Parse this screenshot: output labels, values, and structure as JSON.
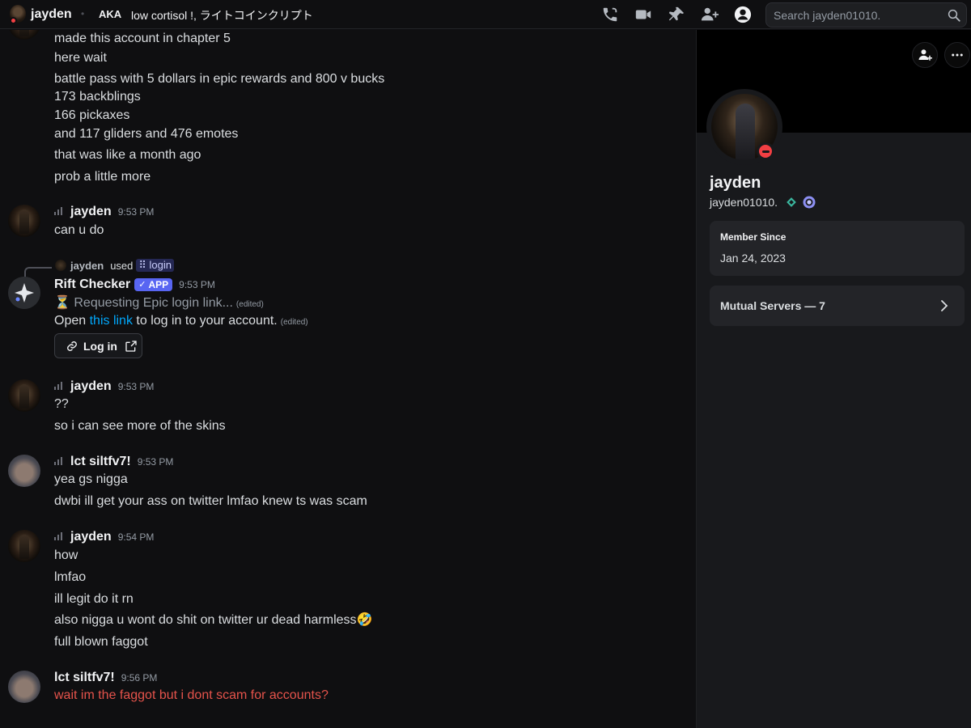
{
  "topbar": {
    "name": "jayden",
    "aka_label": "AKA",
    "nicknames": "low cortisol !, ライトコインクリプト",
    "search_placeholder": "Search jayden01010.",
    "icons": [
      "voice-call-icon",
      "video-call-icon",
      "pin-icon",
      "add-friends-icon",
      "user-profile-icon",
      "search-icon"
    ]
  },
  "chat": {
    "lines_top": [
      "made this account in chapter 5",
      "here wait",
      "battle pass with 5 dollars in epic rewards and 800 v bucks",
      "173 backblings",
      "166 pickaxes",
      "and 117 gliders and 476 emotes",
      "that was like a month ago",
      "prob a little more"
    ],
    "msg1": {
      "author": "jayden",
      "time": "9:53 PM",
      "lines": [
        "can u do"
      ]
    },
    "reply": {
      "author": "jayden",
      "used": "used",
      "command": "login"
    },
    "bot": {
      "author": "Rift Checker",
      "badge": "APP",
      "time": "9:53 PM",
      "line1": "⏳ Requesting Epic login link...",
      "edited": "(edited)",
      "line2_pre": "Open ",
      "line2_link": "this link",
      "line2_post": " to log in to your account.",
      "button": "Log in"
    },
    "msg2": {
      "author": "jayden",
      "time": "9:53 PM",
      "lines": [
        "??",
        "so i can see more of the skins"
      ]
    },
    "msg3": {
      "author": "lct siltfv7!",
      "time": "9:53 PM",
      "lines": [
        "yea gs nigga",
        "dwbi ill get your ass on twitter lmfao knew ts was scam"
      ]
    },
    "msg4": {
      "author": "jayden",
      "time": "9:54 PM",
      "lines": [
        "how",
        "lmfao",
        "ill legit do it rn",
        "also nigga u wont do shit on twitter ur dead harmless🤣",
        "full blown faggot"
      ]
    },
    "msg5": {
      "author": "lct siltfv7!",
      "time": "9:56 PM",
      "lines": [
        "wait im the faggot but i dont scam for accounts?"
      ]
    }
  },
  "profile": {
    "display_name": "jayden",
    "username": "jayden01010.",
    "member_since_label": "Member Since",
    "member_since": "Jan 24, 2023",
    "mutual_servers": "Mutual Servers — 7"
  },
  "colors": {
    "background": "#0f0f11",
    "panel": "#18191c",
    "accent": "#5865f2",
    "link": "#00a8fc",
    "dnd": "#f23f43",
    "mention_red": "#e5534b"
  }
}
